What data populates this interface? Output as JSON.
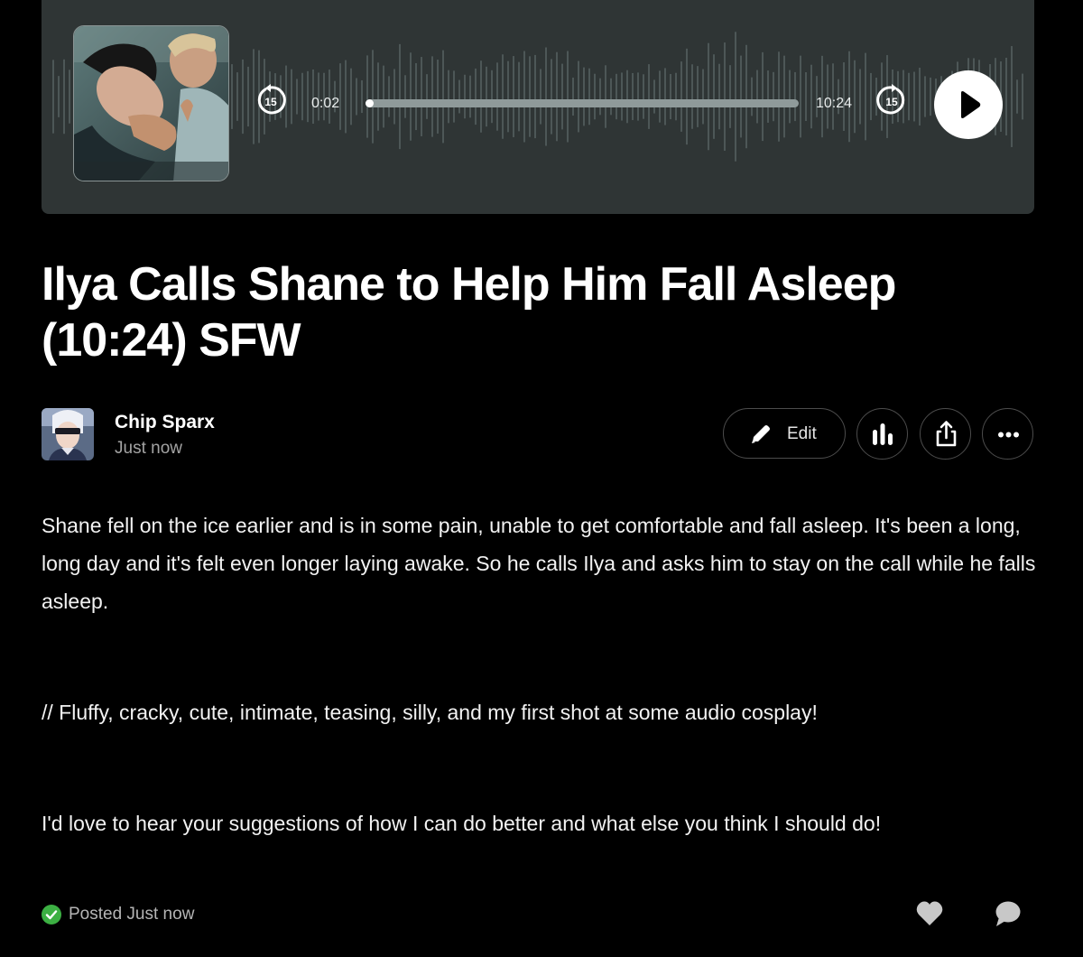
{
  "player": {
    "current_time": "0:02",
    "total_time": "10:24",
    "skip_back_seconds": "15",
    "skip_forward_seconds": "15",
    "progress_fraction": 0.003,
    "background_color": "#2f3535"
  },
  "episode": {
    "title": "Ilya Calls Shane to Help Him Fall Asleep (10:24) SFW"
  },
  "author": {
    "name": "Chip Sparx",
    "posted": "Just now"
  },
  "actions": {
    "edit_label": "Edit",
    "stats_icon": "bar-chart-icon",
    "share_icon": "share-icon",
    "more_icon": "ellipsis-icon"
  },
  "body": {
    "paragraph_1": "Shane fell on the ice earlier and is in some pain, unable to get comfortable and fall asleep. It's been a long, long day and it's felt even longer laying awake. So he calls Ilya and asks him to stay on the call while he falls asleep.",
    "paragraph_2": "// Fluffy, cracky, cute, intimate, teasing, silly, and my first shot at some audio cosplay!",
    "paragraph_3": "I'd love to hear your suggestions of how I can do better and what else you think I should do!"
  },
  "footer": {
    "status_text": "Posted Just now",
    "status_color": "#3cb043",
    "like_icon": "heart-icon",
    "comment_icon": "comment-icon"
  }
}
